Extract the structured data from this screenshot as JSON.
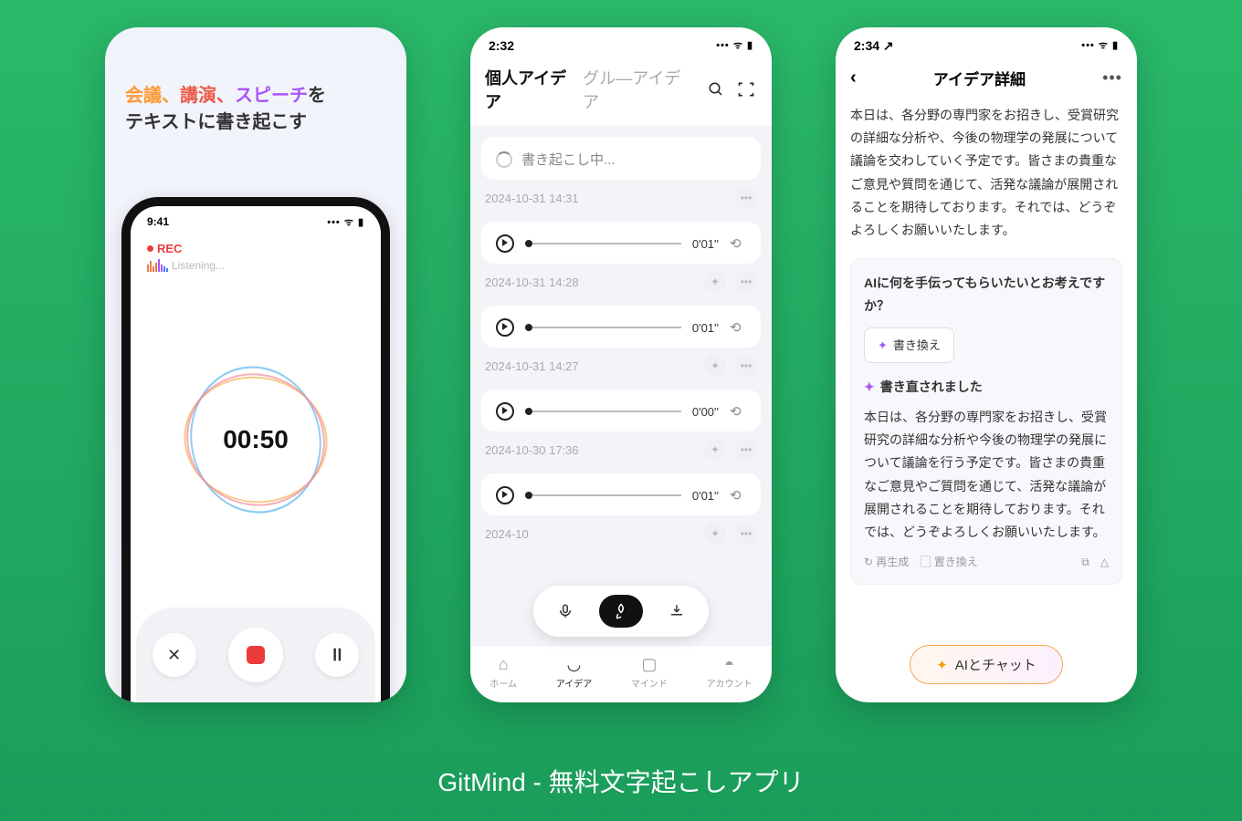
{
  "caption": "GitMind - 無料文字起こしアプリ",
  "phone1": {
    "headline_part1": "会議、",
    "headline_part2": "講演、",
    "headline_part3": "スピーチ",
    "headline_part4": "を",
    "headline_line2": "テキストに書き起こす",
    "status_time": "9:41",
    "rec_label": "REC",
    "listening": "Listening...",
    "timer": "00:50"
  },
  "phone2": {
    "status_time": "2:32",
    "tab_personal": "個人アイデア",
    "tab_group": "グル―アイデア",
    "processing": "書き起こし中...",
    "items": [
      {
        "ts": "2024-10-31 14:31",
        "dur": "",
        "processing": true
      },
      {
        "ts": "2024-10-31 14:28",
        "dur": "0'01''"
      },
      {
        "ts": "2024-10-31 14:27",
        "dur": "0'01''"
      },
      {
        "ts": "2024-10-30 17:36",
        "dur": "0'00''"
      },
      {
        "ts": "2024-10",
        "dur": "0'01''"
      }
    ],
    "nav": {
      "home": "ホーム",
      "idea": "アイデア",
      "mind": "マインド",
      "account": "アカウント"
    }
  },
  "phone3": {
    "status_time": "2:34",
    "title": "アイデア詳細",
    "paragraph1": "本日は、各分野の専門家をお招きし、受賞研究の詳細な分析や、今後の物理学の発展について議論を交わしていく予定です。皆さまの貴重なご意見や質問を通じて、活発な議論が展開されることを期待しております。それでは、どうぞよろしくお願いいたします。",
    "ai_question": "AIに何を手伝ってもらいたいとお考えですか？",
    "rewrite_btn": "書き換え",
    "rewritten_label": "書き直されました",
    "paragraph2": "本日は、各分野の専門家をお招きし、受賞研究の詳細な分析や今後の物理学の発展について議論を行う予定です。皆さまの貴重なご意見やご質問を通じて、活発な議論が展開されることを期待しております。それでは、どうぞよろしくお願いいたします。",
    "regenerate": "再生成",
    "replace": "置き換え",
    "chat_btn": "AIとチャット"
  }
}
